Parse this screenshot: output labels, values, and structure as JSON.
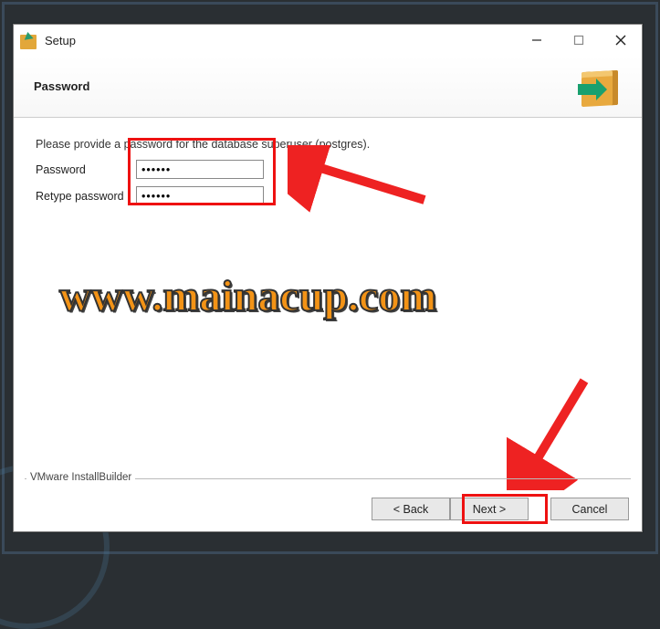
{
  "titlebar": {
    "title": "Setup"
  },
  "header": {
    "title": "Password"
  },
  "content": {
    "instruction": "Please provide a password for the database superuser (postgres).",
    "password_label": "Password",
    "retype_label": "Retype password",
    "password_value": "••••••",
    "retype_value": "••••••"
  },
  "footer": {
    "group_label": "VMware InstallBuilder",
    "back": "< Back",
    "next": "Next >",
    "cancel": "Cancel"
  },
  "watermark": "www.mainacup.com"
}
